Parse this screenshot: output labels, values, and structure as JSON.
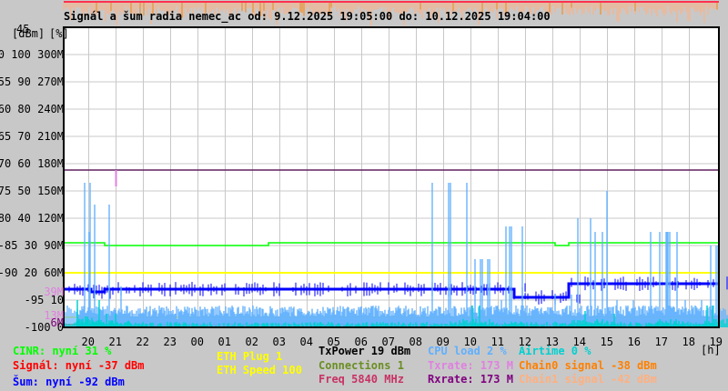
{
  "chart_data": {
    "type": "line",
    "title": "Signál a šum radia nemec_ac od: 9.12.2025 19:05:00 do: 10.12.2025 19:04:00",
    "axis_units": {
      "dbm": "[dBm]",
      "percent": "[%]",
      "hours": "[h]"
    },
    "y_axis": {
      "dbm_range": [
        -100,
        -45
      ],
      "percent_range": [
        0,
        110
      ],
      "rate_range_M": [
        0,
        330
      ],
      "top_label": "45",
      "tick_labels": [
        "-50 100 300M",
        "-55 90 270M",
        "-60 80 240M",
        "-65 70 210M",
        "-70 60 180M",
        "-75 50 150M",
        "-80 40 120M",
        "-85 30 90M",
        "-90 20 60M",
        "-95 10",
        "-100 0"
      ],
      "min_markers": [
        {
          "label": "39M",
          "color": "#e080e0"
        },
        {
          "label": "13M",
          "color": "#e080e0"
        },
        {
          "label": "6M",
          "color": "#800080"
        }
      ]
    },
    "x_axis": {
      "start": "19:05",
      "end": "19:04",
      "tick_labels": [
        "20",
        "21",
        "22",
        "23",
        "00",
        "01",
        "02",
        "03",
        "04",
        "05",
        "06",
        "07",
        "08",
        "09",
        "10",
        "11",
        "12",
        "13",
        "14",
        "15",
        "16",
        "17",
        "18",
        "19"
      ],
      "grid": true
    },
    "x": [
      "19:05",
      "19:35",
      "20:05",
      "20:35",
      "21:05",
      "21:35",
      "22:05",
      "22:35",
      "23:05",
      "23:35",
      "00:05",
      "00:35",
      "01:05",
      "01:35",
      "02:05",
      "02:35",
      "03:05",
      "03:35",
      "04:05",
      "04:35",
      "05:05",
      "05:35",
      "06:05",
      "06:35",
      "07:05",
      "07:35",
      "08:05",
      "08:35",
      "09:05",
      "09:35",
      "10:05",
      "10:35",
      "11:05",
      "11:35",
      "12:05",
      "12:35",
      "13:05",
      "13:35",
      "14:05",
      "14:35",
      "15:05",
      "15:35",
      "16:05",
      "16:35",
      "17:05",
      "17:35",
      "18:05",
      "18:35"
    ],
    "series": [
      {
        "name": "CINR",
        "unit": "%",
        "color": "#00ff00",
        "values": [
          31,
          31,
          31,
          30,
          30,
          30,
          30,
          30,
          30,
          30,
          30,
          30,
          30,
          30,
          30,
          31,
          31,
          31,
          31,
          31,
          31,
          31,
          31,
          31,
          31,
          31,
          31,
          31,
          31,
          31,
          31,
          31,
          31,
          31,
          31,
          31,
          30,
          31,
          31,
          31,
          31,
          31,
          31,
          31,
          31,
          31,
          31,
          31
        ]
      },
      {
        "name": "Šum",
        "unit": "dBm",
        "color": "#0000ff",
        "values": [
          -93,
          -93,
          -93.5,
          -93,
          -93,
          -93,
          -93,
          -93,
          -93,
          -93,
          -93,
          -93,
          -93,
          -93,
          -93,
          -93,
          -93,
          -93,
          -93,
          -93,
          -93,
          -93,
          -93,
          -93,
          -93,
          -93,
          -93,
          -93,
          -93,
          -93,
          -93,
          -93,
          -93,
          -94.5,
          -94.5,
          -94.5,
          -94.5,
          -92,
          -92,
          -92,
          -92,
          -92,
          -92,
          -92,
          -92,
          -92,
          -92,
          -92
        ]
      },
      {
        "name": "TxPower",
        "unit": "dBm",
        "color": "#000000",
        "values": [
          17,
          17,
          18,
          17,
          17,
          17,
          17,
          17,
          17,
          17,
          17,
          17,
          17,
          17,
          17,
          18,
          18,
          18,
          18,
          18,
          18,
          18,
          18,
          18,
          18,
          18,
          18,
          18,
          18,
          19,
          18,
          18,
          18,
          18,
          18,
          18,
          19,
          19,
          18,
          18,
          18,
          18,
          18,
          18,
          18,
          18,
          18,
          18
        ]
      },
      {
        "name": "CPU load",
        "unit": "%",
        "color": "#60b0ff",
        "values": [
          35,
          53,
          45,
          15,
          5,
          4,
          4,
          3,
          5,
          4,
          5,
          6,
          5,
          4,
          4,
          5,
          4,
          4,
          6,
          5,
          4,
          4,
          5,
          5,
          4,
          4,
          6,
          53,
          20,
          53,
          25,
          10,
          37,
          8,
          6,
          5,
          12,
          40,
          35,
          50,
          10,
          8,
          6,
          35,
          35,
          10,
          8,
          30
        ]
      },
      {
        "name": "Airtime",
        "unit": "%",
        "color": "#00d0d0",
        "values": [
          4,
          10,
          8,
          5,
          1,
          0,
          0,
          0,
          0,
          0,
          0,
          0,
          0,
          0,
          0,
          0,
          0,
          0,
          0,
          0,
          0,
          0,
          0,
          0,
          0,
          0,
          0,
          2,
          0,
          8,
          3,
          1,
          2,
          1,
          0,
          0,
          1,
          6,
          3,
          5,
          1,
          0,
          0,
          3,
          4,
          1,
          1,
          8
        ]
      },
      {
        "name": "Rxrate",
        "unit": "M",
        "color": "#602060",
        "values": [
          173,
          173,
          173,
          173,
          173,
          173,
          173,
          173,
          173,
          173,
          173,
          173,
          173,
          173,
          173,
          173,
          173,
          173,
          173,
          173,
          173,
          173,
          173,
          173,
          173,
          173,
          173,
          173,
          173,
          173,
          173,
          173,
          173,
          173,
          173,
          173,
          173,
          173,
          173,
          173,
          173,
          173,
          173,
          173,
          173,
          173,
          173,
          173
        ]
      }
    ],
    "constant_lines": [
      {
        "name": "ETH Speed",
        "value": 100,
        "color": "#ffff00"
      },
      {
        "name": "ETH Plug",
        "value": 1,
        "color": "#ffff00"
      },
      {
        "name": "Connections",
        "value": 1,
        "color": "#6b8e23"
      }
    ],
    "txrate_spike_at": "21:00",
    "legend": [
      {
        "text": "CINR: nyní 31 %",
        "color": "#00ff00"
      },
      {
        "text": "Signál: nyní -37 dBm",
        "color": "#ff0000"
      },
      {
        "text": "Šum: nyní -92 dBm",
        "color": "#0000ff"
      },
      {
        "text": "ETH Plug 1",
        "color": "#ffff00"
      },
      {
        "text": "ETH Speed 100",
        "color": "#ffff00"
      },
      {
        "text": "TxPower 19 dBm",
        "color": "#000000"
      },
      {
        "text": "Connections 1",
        "color": "#6b8e23"
      },
      {
        "text": "Freq 5840 MHz",
        "color": "#c83264"
      },
      {
        "text": "CPU load 2 %",
        "color": "#60b0ff"
      },
      {
        "text": "Txrate: 173 M",
        "color": "#e080e0"
      },
      {
        "text": "Rxrate: 173 M",
        "color": "#800080"
      },
      {
        "text": "Airtime 0 %",
        "color": "#00d0d0"
      },
      {
        "text": "Chain0 signal -38 dBm",
        "color": "#ff8000"
      },
      {
        "text": "Chain1 signal -42 dBm",
        "color": "#ffb080"
      }
    ]
  }
}
